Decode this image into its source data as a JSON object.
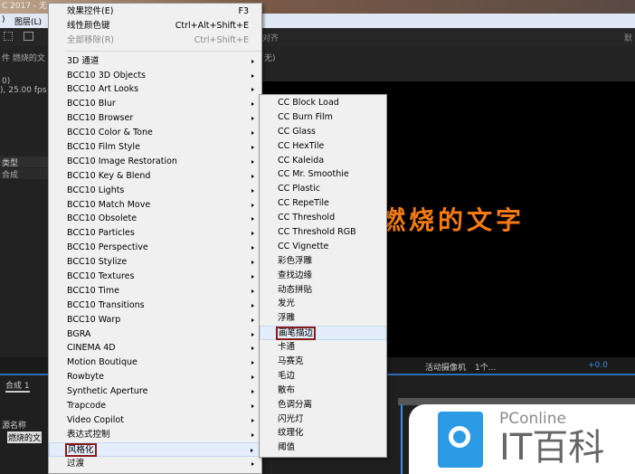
{
  "window": {
    "title": "C 2017 - 无"
  },
  "menubar": {
    "items": [
      ")",
      "图层(L)"
    ]
  },
  "toolbar": {
    "align": "对齐",
    "right": "默"
  },
  "panel": {
    "label": "件 燃烧的文",
    "none": "无)",
    "info1": "0)",
    "info2": "), 25.00 fps",
    "type_header": "类型",
    "type_value": "合成"
  },
  "viewer": {
    "text": "燃烧的文字",
    "camera": "活动摄像机",
    "views": "1个...",
    "exposure": "+0.0"
  },
  "timeline": {
    "tab": "合成 1",
    "col": "源名称",
    "layer": "燃烧的文"
  },
  "menu": {
    "top": [
      {
        "label": "效果控件(E)",
        "shortcut": "F3"
      },
      {
        "label": "线性颜色键",
        "shortcut": "Ctrl+Alt+Shift+E"
      },
      {
        "label": "全部移除(R)",
        "shortcut": "Ctrl+Shift+E",
        "disabled": true
      }
    ],
    "items": [
      "3D 通道",
      "BCC10 3D Objects",
      "BCC10 Art Looks",
      "BCC10 Blur",
      "BCC10 Browser",
      "BCC10 Color & Tone",
      "BCC10 Film Style",
      "BCC10 Image Restoration",
      "BCC10 Key & Blend",
      "BCC10 Lights",
      "BCC10 Match Move",
      "BCC10 Obsolete",
      "BCC10 Particles",
      "BCC10 Perspective",
      "BCC10 Stylize",
      "BCC10 Textures",
      "BCC10 Time",
      "BCC10 Transitions",
      "BCC10 Warp",
      "BGRA",
      "CINEMA 4D",
      "Motion Boutique",
      "Rowbyte",
      "Synthetic Aperture",
      "Trapcode",
      "Video Copilot",
      "表达式控制",
      "风格化",
      "过渡"
    ],
    "selected": "风格化"
  },
  "submenu": {
    "items": [
      "CC Block Load",
      "CC Burn Film",
      "CC Glass",
      "CC HexTile",
      "CC Kaleida",
      "CC Mr. Smoothie",
      "CC Plastic",
      "CC RepeTile",
      "CC Threshold",
      "CC Threshold RGB",
      "CC Vignette",
      "彩色浮雕",
      "查找边缘",
      "动态拼贴",
      "发光",
      "浮雕",
      "画笔描边",
      "卡通",
      "马赛克",
      "毛边",
      "散布",
      "色调分离",
      "闪光灯",
      "纹理化",
      "阈值"
    ],
    "selected": "画笔描边"
  },
  "watermark": {
    "brand": "PConline",
    "name": "IT百科"
  }
}
